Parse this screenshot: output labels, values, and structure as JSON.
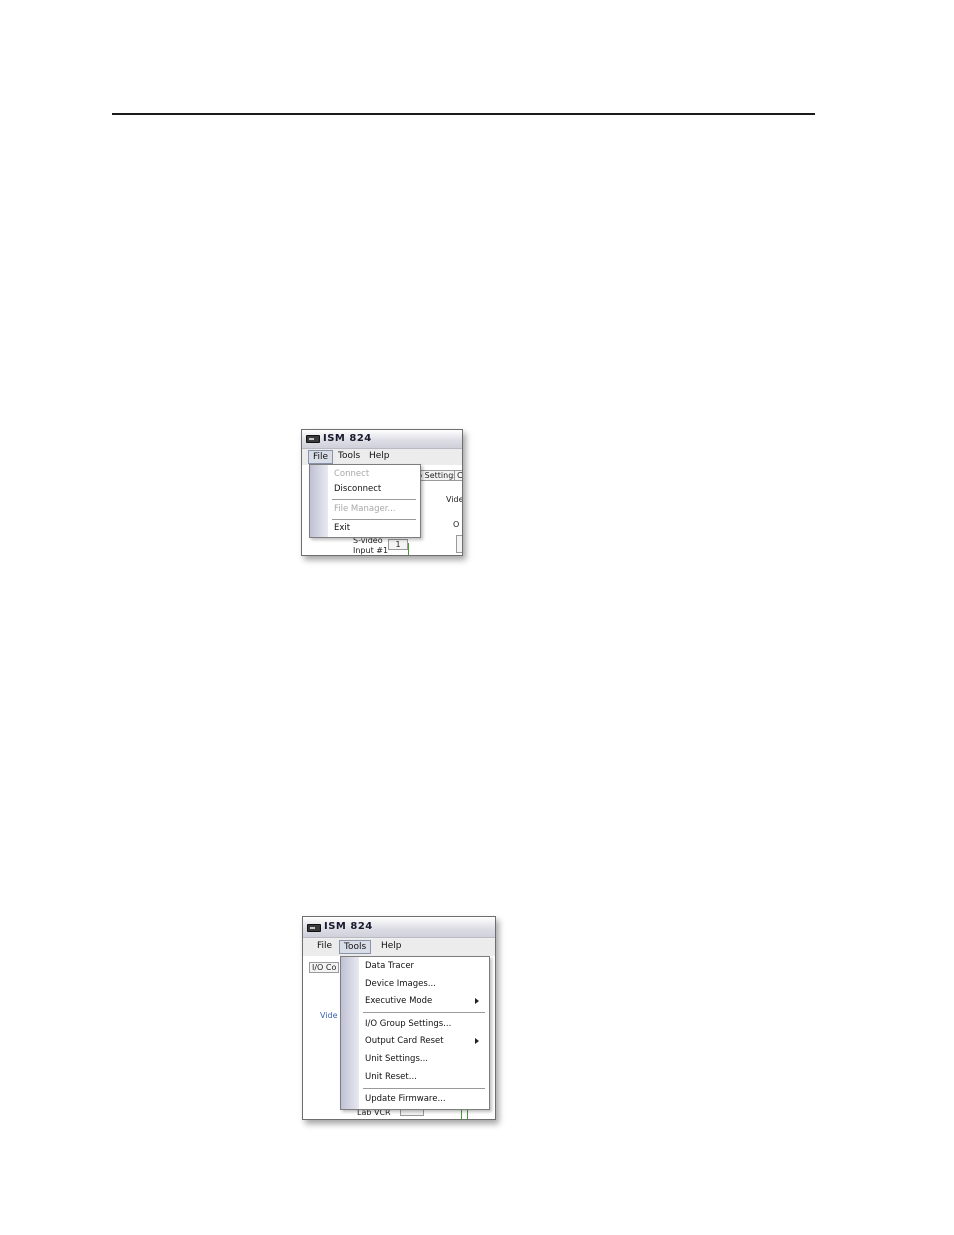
{
  "screenshot_file": {
    "title": "ISM 824",
    "menus": [
      "File",
      "Tools",
      "Help"
    ],
    "active_menu": "File",
    "dropdown_items": [
      {
        "label": "Connect",
        "enabled": false
      },
      {
        "label": "Disconnect",
        "enabled": true
      },
      {
        "label": "File Manager...",
        "enabled": false
      },
      {
        "label": "Exit",
        "enabled": true
      }
    ],
    "background_fragments": {
      "tab_settings": "p Settings",
      "tab_next": "C",
      "video": "Vide",
      "output": "O",
      "svideo_line1": "S-video",
      "svideo_line2": "Input #1",
      "input_number": "1"
    }
  },
  "screenshot_tools": {
    "title": "ISM 824",
    "menus": [
      "File",
      "Tools",
      "Help"
    ],
    "active_menu": "Tools",
    "dropdown_items": [
      {
        "label": "Data Tracer",
        "submenu": false
      },
      {
        "label": "Device Images...",
        "submenu": false
      },
      {
        "label": "Executive Mode",
        "submenu": true
      },
      {
        "label": "I/O Group Settings...",
        "submenu": false
      },
      {
        "label": "Output Card Reset",
        "submenu": true
      },
      {
        "label": "Unit Settings...",
        "submenu": false
      },
      {
        "label": "Unit Reset...",
        "submenu": false
      },
      {
        "label": "Update Firmware...",
        "submenu": false
      }
    ],
    "background_fragments": {
      "tab_io": "I/O Co",
      "video": "Vide",
      "lab_vcr": "Lab VCR"
    }
  }
}
